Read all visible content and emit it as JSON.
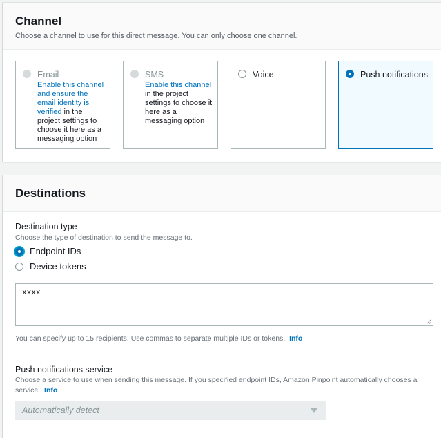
{
  "channel": {
    "title": "Channel",
    "description": "Choose a channel to use for this direct message. You can only choose one channel.",
    "options": [
      {
        "label": "Email",
        "link_text": "Enable this channel and ensure the email identity is verified",
        "rest_text": " in the project settings to choose it here as a messaging option",
        "state": "disabled"
      },
      {
        "label": "SMS",
        "link_text": "Enable this channel",
        "rest_text": " in the project settings to choose it here as a messaging option",
        "state": "disabled"
      },
      {
        "label": "Voice",
        "state": "unselected"
      },
      {
        "label": "Push notifications",
        "state": "selected"
      }
    ]
  },
  "destinations": {
    "title": "Destinations",
    "destination_type": {
      "label": "Destination type",
      "description": "Choose the type of destination to send the message to.",
      "options": [
        {
          "label": "Endpoint IDs",
          "selected": true
        },
        {
          "label": "Device tokens",
          "selected": false
        }
      ]
    },
    "recipients_value": "xxxx",
    "recipients_hint": "You can specify up to 15 recipients. Use commas to separate multiple IDs or tokens.",
    "info_label": "Info",
    "push_service": {
      "label": "Push notifications service",
      "description": "Choose a service to use when sending this message. If you specified endpoint IDs, Amazon Pinpoint automatically chooses a service.",
      "info_label": "Info",
      "selected_value": "Automatically detect"
    }
  },
  "colors": {
    "accent": "#0073bb",
    "focus": "#00a1c9",
    "disabled": "#879596"
  }
}
